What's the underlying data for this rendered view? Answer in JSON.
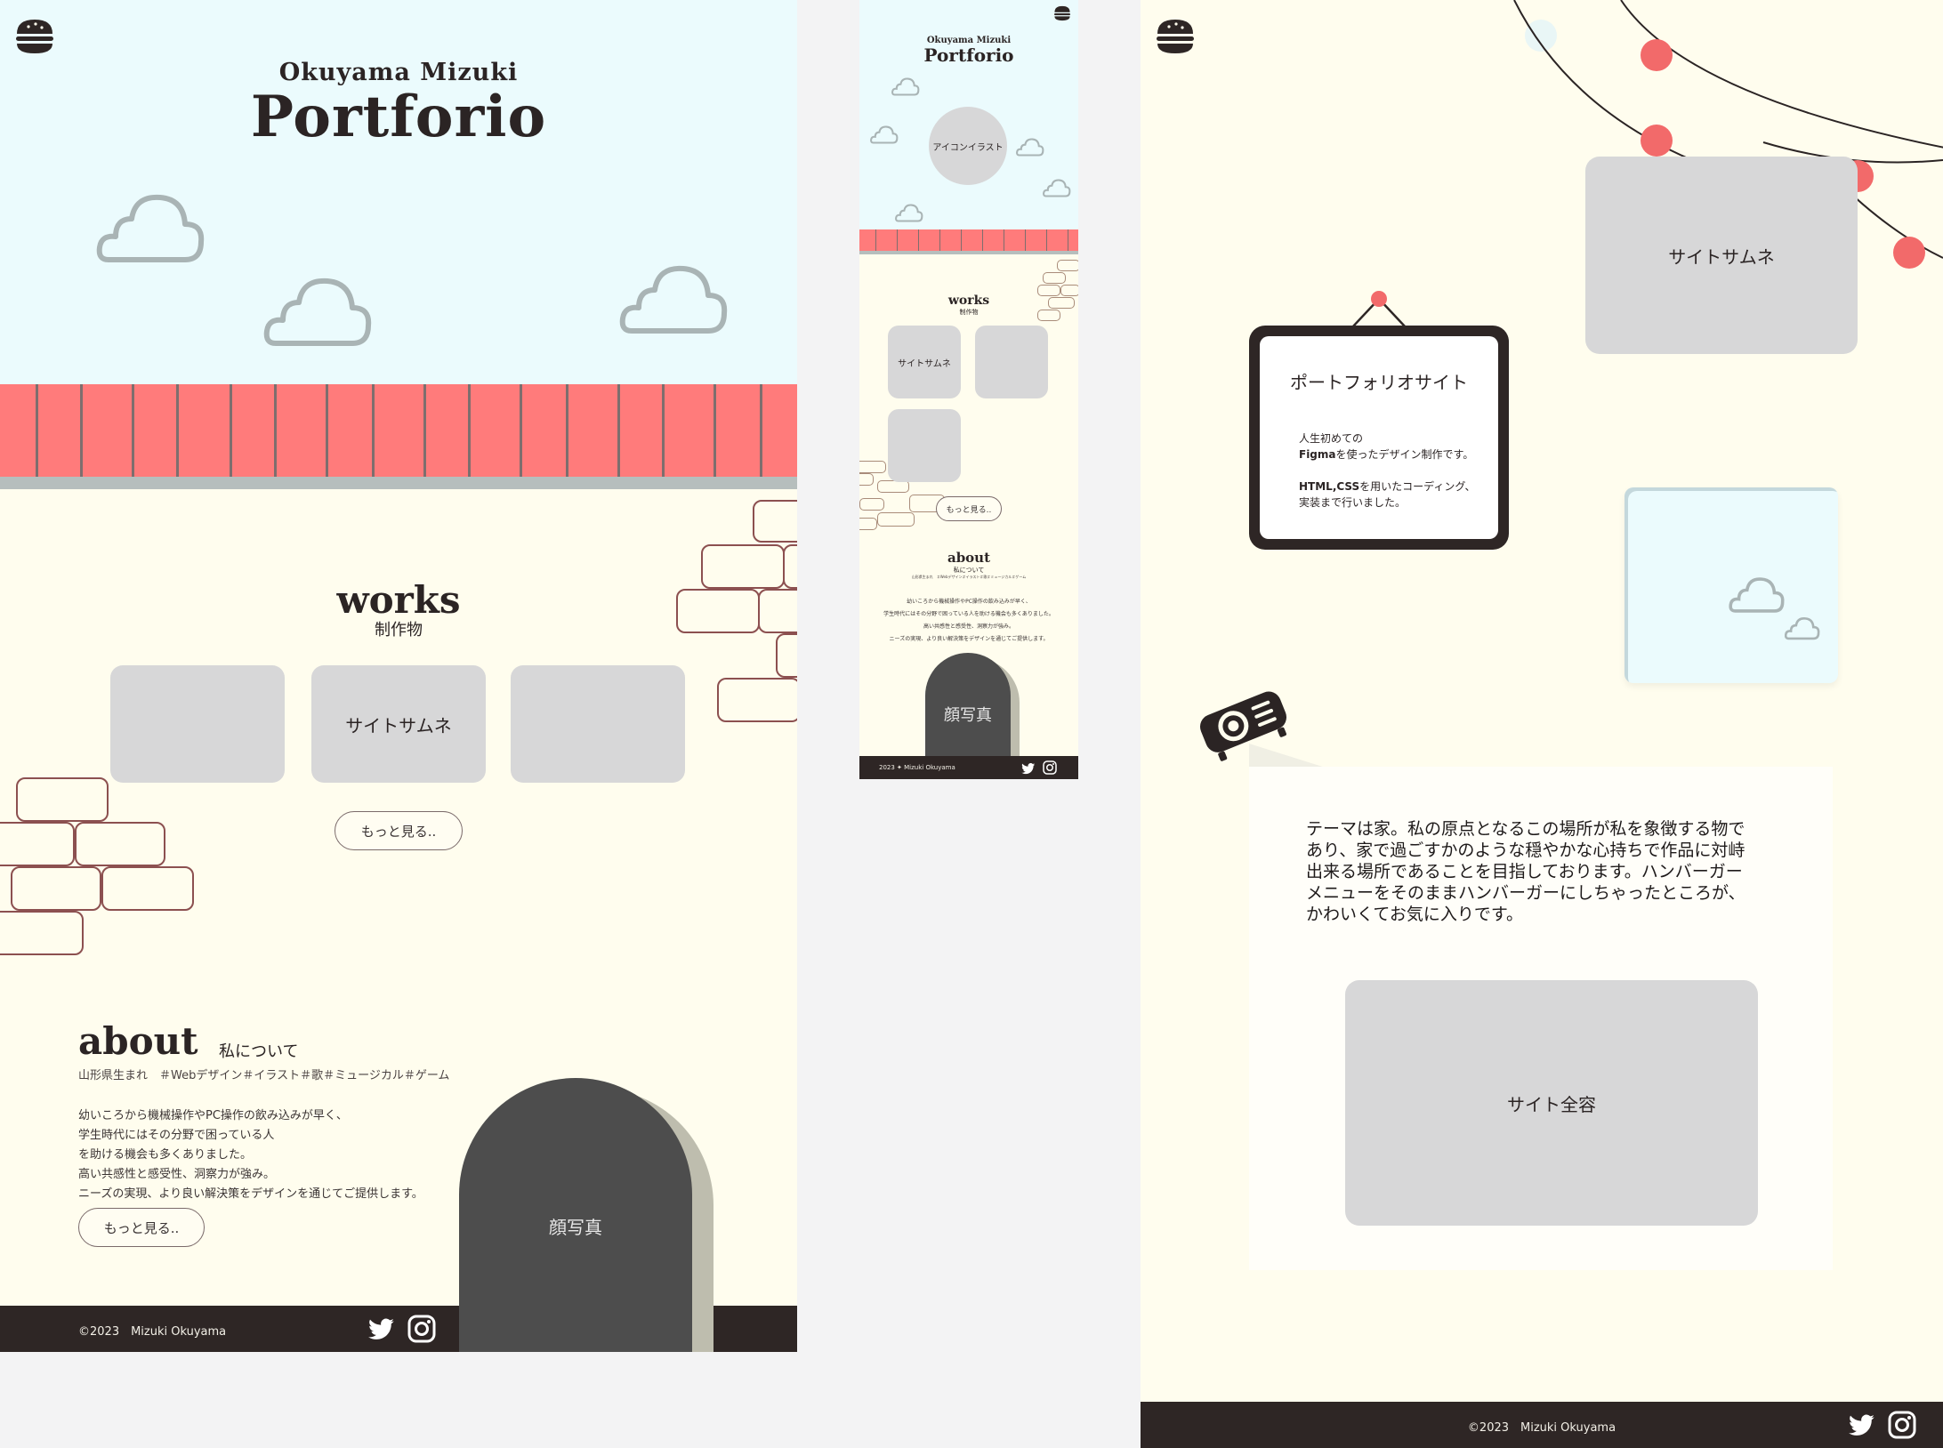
{
  "desktop": {
    "header": {
      "subtitle": "Okuyama Mizuki",
      "title": "Portforio",
      "menu_icon": "hamburger-icon"
    },
    "works": {
      "heading": "works",
      "subheading": "制作物",
      "thumbs": [
        "",
        "サイトサムネ",
        ""
      ],
      "more_label": "もっと見る.."
    },
    "about": {
      "heading": "about",
      "subheading": "私について",
      "tags": "山形県生まれ　＃Webデザイン＃イラスト＃歌＃ミュージカル＃ゲーム",
      "lines": [
        "幼いころから機械操作やPC操作の飲み込みが早く、",
        "学生時代にはその分野で困っている人",
        "を助ける機会も多くありました。",
        "高い共感性と感受性、洞察力が強み。",
        "ニーズの実現、より良い解決策をデザインを通じてご提供します。"
      ],
      "more_label": "もっと見る..",
      "photo_label": "顔写真"
    },
    "footer": {
      "copyright": "©2023　Mizuki Okuyama",
      "icons": [
        "twitter-icon",
        "instagram-icon"
      ]
    }
  },
  "mobile": {
    "header": {
      "subtitle": "Okuyama Mizuki",
      "title": "Portforio",
      "menu_icon": "hamburger-icon"
    },
    "icon_label": "アイコンイラスト",
    "works": {
      "heading": "works",
      "subheading": "制作物",
      "thumbs": [
        "サイトサムネ",
        "",
        ""
      ],
      "more_label": "もっと見る.."
    },
    "about": {
      "heading": "about",
      "subheading": "私について",
      "tags": "山形県生まれ　＃Webデザイン＃イラスト＃歌＃ミュージカル＃ゲーム",
      "lines": [
        "幼いころから機械操作やPC操作の飲み込みが早く、",
        "学生時代にはその分野で困っている人を助ける機会も多くありました。",
        "高い共感性と感受性、洞察力が強み。",
        "ニーズの実現、より良い解決策をデザインを通じてご提供します。"
      ],
      "photo_label": "顔写真"
    },
    "footer": {
      "copyright": "2023 ✦ Mizuki Okuyama"
    }
  },
  "detail": {
    "thumb_label": "サイトサムネ",
    "frame": {
      "title": "ポートフォリオサイト",
      "line1": "人生初めての",
      "line2_bold": "Figma",
      "line2_rest": "を使ったデザイン制作です。",
      "line3_bold": "HTML,CSS",
      "line3_rest": "を用いたコーディング、",
      "line4": "実装まで行いました。"
    },
    "description": [
      "テーマは家。私の原点となるこの場所が私を象徴する物で",
      "あり、家で過ごすかのような穏やかな心持ちで作品に対峙",
      "出来る場所であることを目指しております。ハンバーガー",
      "メニューをそのままハンバーガーにしちゃったところが、",
      "かわいくてお気に入りです。"
    ],
    "full_label": "サイト全容",
    "footer": {
      "copyright": "©2023　Mizuki Okuyama"
    }
  },
  "colors": {
    "sky": "#ebfbfd",
    "cream": "#fffdee",
    "roof": "#ff7b7b",
    "dark": "#2e2625",
    "thumb": "#d7d7d8",
    "brick": "#8c5050",
    "cloud": "#a9b4b5",
    "photo": "#4d4d4d"
  }
}
